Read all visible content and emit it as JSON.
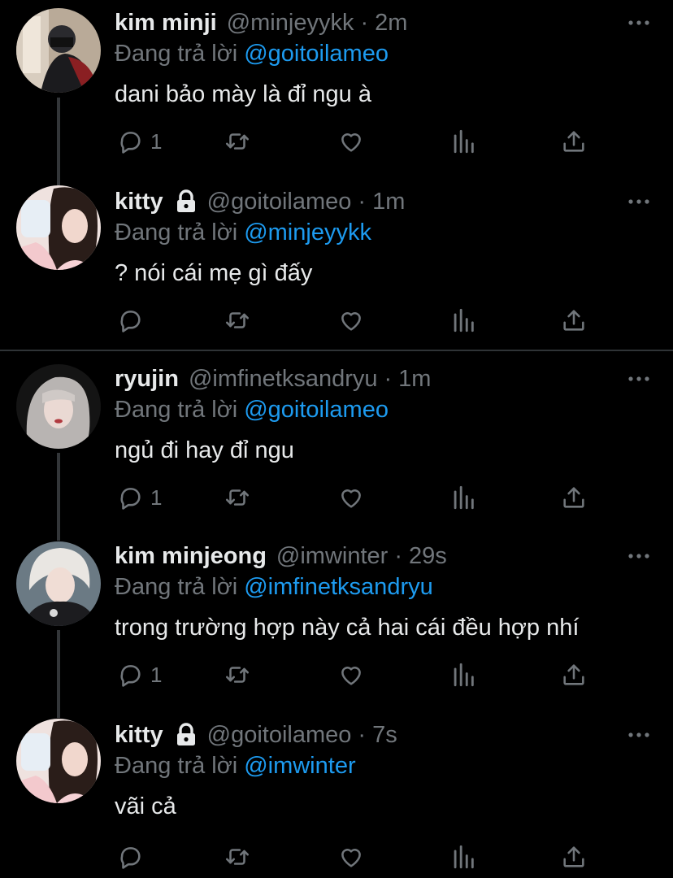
{
  "colors": {
    "background": "#000000",
    "text": "#e7e9ea",
    "muted": "#71767b",
    "link": "#1d9bf0",
    "thread_line": "#333639"
  },
  "reply_prefix": "Đang trả lời",
  "icons": [
    "reply-icon",
    "retweet-icon",
    "like-icon",
    "views-icon",
    "share-icon",
    "more-icon",
    "lock-icon"
  ],
  "tweets": [
    {
      "name": "kim minji",
      "handle": "@minjeyykk",
      "time": "2m",
      "replying_to": "@goitoilameo",
      "text": "dani bảo mày là đỉ ngu à",
      "reply_count": "1"
    },
    {
      "name": "kitty",
      "handle": "@goitoilameo",
      "time": "1m",
      "replying_to": "@minjeyykk",
      "text": "? nói cái mẹ gì đấy",
      "reply_count": ""
    },
    {
      "name": "ryujin",
      "handle": "@imfinetksandryu",
      "time": "1m",
      "replying_to": "@goitoilameo",
      "text": "ngủ đi hay đỉ ngu",
      "reply_count": "1"
    },
    {
      "name": "kim minjeong",
      "handle": "@imwinter",
      "time": "29s",
      "replying_to": "@imfinetksandryu",
      "text": "trong trường hợp này cả hai cái đều hợp nhí",
      "reply_count": "1"
    },
    {
      "name": "kitty",
      "handle": "@goitoilameo",
      "time": "7s",
      "replying_to": "@imwinter",
      "text": "vãi cả",
      "reply_count": ""
    }
  ]
}
